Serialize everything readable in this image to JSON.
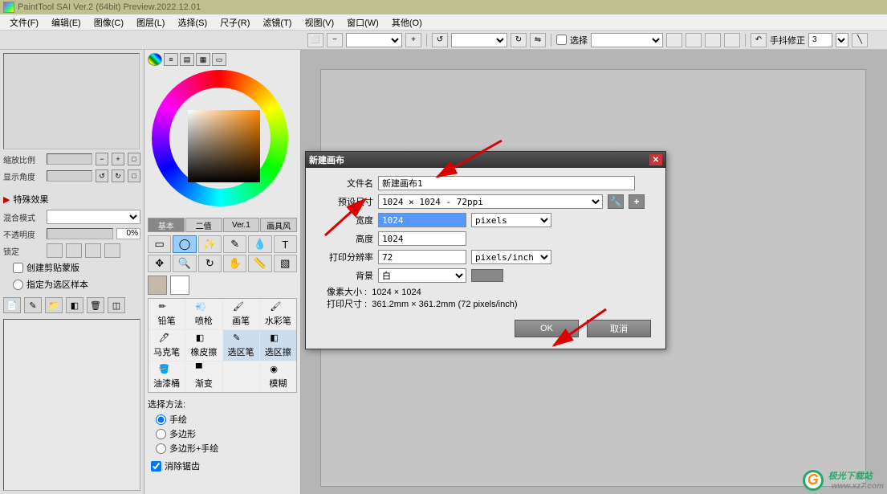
{
  "app": {
    "title": "PaintTool SAI Ver.2 (64bit) Preview.2022.12.01"
  },
  "menu": [
    "文件(F)",
    "编辑(E)",
    "图像(C)",
    "图层(L)",
    "选择(S)",
    "尺子(R)",
    "滤镜(T)",
    "视图(V)",
    "窗口(W)",
    "其他(O)"
  ],
  "toolbar": {
    "select_label": "选择",
    "stabilizer_label": "手抖修正",
    "stabilizer_value": "3"
  },
  "left": {
    "zoom_label": "缩放比例",
    "angle_label": "显示角度",
    "fx_label": "特殊效果",
    "blend_label": "混合模式",
    "opacity_label": "不透明度",
    "opacity_value": "0%",
    "lock_label": "锁定",
    "cb_clip": "创建剪贴蒙版",
    "cb_selsample": "指定为选区样本"
  },
  "tool_tabs": [
    "基本",
    "二值",
    "Ver.1",
    "画具风"
  ],
  "brushes": [
    "铅笔",
    "喷枪",
    "画笔",
    "水彩笔",
    "马克笔",
    "橡皮擦",
    "选区笔",
    "选区擦",
    "油漆桶",
    "渐变",
    "",
    "模糊"
  ],
  "sel_method": {
    "hdr": "选择方法:",
    "opts": [
      "手绘",
      "多边形",
      "多边形+手绘"
    ],
    "anti": "消除锯齿"
  },
  "dialog": {
    "title": "新建画布",
    "filename_label": "文件名",
    "filename_value": "新建画布1",
    "preset_label": "预设尺寸",
    "preset_value": "1024 × 1024 - 72ppi",
    "width_label": "宽度",
    "width_value": "1024",
    "height_label": "高度",
    "height_value": "1024",
    "size_unit": "pixels",
    "res_label": "打印分辨率",
    "res_value": "72",
    "res_unit": "pixels/inch",
    "bg_label": "背景",
    "bg_value": "白",
    "pixel_size_label": "像素大小 :",
    "pixel_size_value": "1024 × 1024",
    "print_size_label": "打印尺寸 :",
    "print_size_value": "361.2mm × 361.2mm (72 pixels/inch)",
    "ok": "OK",
    "cancel": "取消"
  },
  "watermark": {
    "text": "极光下载站",
    "sub": "www.xz7.com"
  }
}
